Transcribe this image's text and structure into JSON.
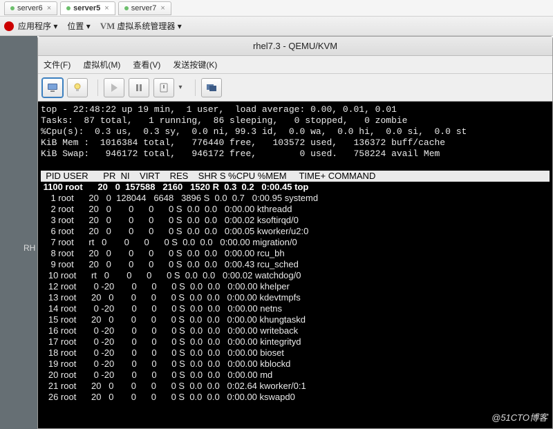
{
  "browser_tabs": [
    {
      "label": "server6",
      "active": false
    },
    {
      "label": "server5",
      "active": true
    },
    {
      "label": "server7",
      "active": false
    }
  ],
  "desktop": {
    "apps": "应用程序",
    "places": "位置",
    "vmm": "虚拟系统管理器"
  },
  "side_label": "RH",
  "vm": {
    "title": "rhel7.3 - QEMU/KVM",
    "menu_file": "文件(F)",
    "menu_vm": "虚拟机(M)",
    "menu_view": "查看(V)",
    "menu_sendkey": "发送按键(K)"
  },
  "top_header": {
    "line1": "top - 22:48:22 up 19 min,  1 user,  load average: 0.00, 0.01, 0.01",
    "line2": "Tasks:  87 total,   1 running,  86 sleeping,   0 stopped,   0 zombie",
    "line3": "%Cpu(s):  0.3 us,  0.3 sy,  0.0 ni, 99.3 id,  0.0 wa,  0.0 hi,  0.0 si,  0.0 st",
    "line4": "KiB Mem :  1016384 total,   776440 free,   103572 used,   136372 buff/cache",
    "line5": "KiB Swap:   946172 total,   946172 free,        0 used.   758224 avail Mem"
  },
  "columns_header": "  PID USER      PR  NI    VIRT    RES    SHR S %CPU %MEM     TIME+ COMMAND           ",
  "rows": [
    {
      "pid": "1100",
      "user": "root",
      "pr": "20",
      "ni": "0",
      "virt": "157588",
      "res": "2160",
      "shr": "1520",
      "s": "R",
      "cpu": "0.3",
      "mem": "0.2",
      "time": "0:00.45",
      "cmd": "top"
    },
    {
      "pid": "1",
      "user": "root",
      "pr": "20",
      "ni": "0",
      "virt": "128044",
      "res": "6648",
      "shr": "3896",
      "s": "S",
      "cpu": "0.0",
      "mem": "0.7",
      "time": "0:00.95",
      "cmd": "systemd"
    },
    {
      "pid": "2",
      "user": "root",
      "pr": "20",
      "ni": "0",
      "virt": "0",
      "res": "0",
      "shr": "0",
      "s": "S",
      "cpu": "0.0",
      "mem": "0.0",
      "time": "0:00.00",
      "cmd": "kthreadd"
    },
    {
      "pid": "3",
      "user": "root",
      "pr": "20",
      "ni": "0",
      "virt": "0",
      "res": "0",
      "shr": "0",
      "s": "S",
      "cpu": "0.0",
      "mem": "0.0",
      "time": "0:00.02",
      "cmd": "ksoftirqd/0"
    },
    {
      "pid": "6",
      "user": "root",
      "pr": "20",
      "ni": "0",
      "virt": "0",
      "res": "0",
      "shr": "0",
      "s": "S",
      "cpu": "0.0",
      "mem": "0.0",
      "time": "0:00.05",
      "cmd": "kworker/u2:0"
    },
    {
      "pid": "7",
      "user": "root",
      "pr": "rt",
      "ni": "0",
      "virt": "0",
      "res": "0",
      "shr": "0",
      "s": "S",
      "cpu": "0.0",
      "mem": "0.0",
      "time": "0:00.00",
      "cmd": "migration/0"
    },
    {
      "pid": "8",
      "user": "root",
      "pr": "20",
      "ni": "0",
      "virt": "0",
      "res": "0",
      "shr": "0",
      "s": "S",
      "cpu": "0.0",
      "mem": "0.0",
      "time": "0:00.00",
      "cmd": "rcu_bh"
    },
    {
      "pid": "9",
      "user": "root",
      "pr": "20",
      "ni": "0",
      "virt": "0",
      "res": "0",
      "shr": "0",
      "s": "S",
      "cpu": "0.0",
      "mem": "0.0",
      "time": "0:00.43",
      "cmd": "rcu_sched"
    },
    {
      "pid": "10",
      "user": "root",
      "pr": "rt",
      "ni": "0",
      "virt": "0",
      "res": "0",
      "shr": "0",
      "s": "S",
      "cpu": "0.0",
      "mem": "0.0",
      "time": "0:00.02",
      "cmd": "watchdog/0"
    },
    {
      "pid": "12",
      "user": "root",
      "pr": "0",
      "ni": "-20",
      "virt": "0",
      "res": "0",
      "shr": "0",
      "s": "S",
      "cpu": "0.0",
      "mem": "0.0",
      "time": "0:00.00",
      "cmd": "khelper"
    },
    {
      "pid": "13",
      "user": "root",
      "pr": "20",
      "ni": "0",
      "virt": "0",
      "res": "0",
      "shr": "0",
      "s": "S",
      "cpu": "0.0",
      "mem": "0.0",
      "time": "0:00.00",
      "cmd": "kdevtmpfs"
    },
    {
      "pid": "14",
      "user": "root",
      "pr": "0",
      "ni": "-20",
      "virt": "0",
      "res": "0",
      "shr": "0",
      "s": "S",
      "cpu": "0.0",
      "mem": "0.0",
      "time": "0:00.00",
      "cmd": "netns"
    },
    {
      "pid": "15",
      "user": "root",
      "pr": "20",
      "ni": "0",
      "virt": "0",
      "res": "0",
      "shr": "0",
      "s": "S",
      "cpu": "0.0",
      "mem": "0.0",
      "time": "0:00.00",
      "cmd": "khungtaskd"
    },
    {
      "pid": "16",
      "user": "root",
      "pr": "0",
      "ni": "-20",
      "virt": "0",
      "res": "0",
      "shr": "0",
      "s": "S",
      "cpu": "0.0",
      "mem": "0.0",
      "time": "0:00.00",
      "cmd": "writeback"
    },
    {
      "pid": "17",
      "user": "root",
      "pr": "0",
      "ni": "-20",
      "virt": "0",
      "res": "0",
      "shr": "0",
      "s": "S",
      "cpu": "0.0",
      "mem": "0.0",
      "time": "0:00.00",
      "cmd": "kintegrityd"
    },
    {
      "pid": "18",
      "user": "root",
      "pr": "0",
      "ni": "-20",
      "virt": "0",
      "res": "0",
      "shr": "0",
      "s": "S",
      "cpu": "0.0",
      "mem": "0.0",
      "time": "0:00.00",
      "cmd": "bioset"
    },
    {
      "pid": "19",
      "user": "root",
      "pr": "0",
      "ni": "-20",
      "virt": "0",
      "res": "0",
      "shr": "0",
      "s": "S",
      "cpu": "0.0",
      "mem": "0.0",
      "time": "0:00.00",
      "cmd": "kblockd"
    },
    {
      "pid": "20",
      "user": "root",
      "pr": "0",
      "ni": "-20",
      "virt": "0",
      "res": "0",
      "shr": "0",
      "s": "S",
      "cpu": "0.0",
      "mem": "0.0",
      "time": "0:00.00",
      "cmd": "md"
    },
    {
      "pid": "21",
      "user": "root",
      "pr": "20",
      "ni": "0",
      "virt": "0",
      "res": "0",
      "shr": "0",
      "s": "S",
      "cpu": "0.0",
      "mem": "0.0",
      "time": "0:02.64",
      "cmd": "kworker/0:1"
    },
    {
      "pid": "26",
      "user": "root",
      "pr": "20",
      "ni": "0",
      "virt": "0",
      "res": "0",
      "shr": "0",
      "s": "S",
      "cpu": "0.0",
      "mem": "0.0",
      "time": "0:00.00",
      "cmd": "kswapd0"
    }
  ],
  "watermark": "@51CTO博客"
}
